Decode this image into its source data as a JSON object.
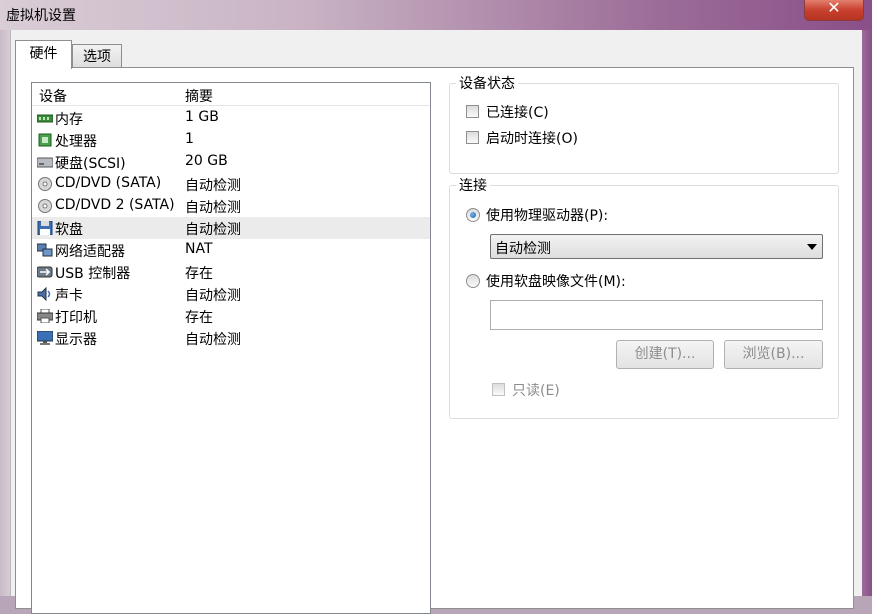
{
  "window": {
    "title": "虚拟机设置",
    "close_label": "✕"
  },
  "tabs": [
    {
      "label": "硬件"
    },
    {
      "label": "选项"
    }
  ],
  "device_list": {
    "columns": [
      "设备",
      "摘要"
    ],
    "rows": [
      {
        "name": "内存",
        "summary": "1 GB",
        "icon": "memory-icon"
      },
      {
        "name": "处理器",
        "summary": "1",
        "icon": "processor-icon"
      },
      {
        "name": "硬盘(SCSI)",
        "summary": "20 GB",
        "icon": "harddisk-icon"
      },
      {
        "name": "CD/DVD (SATA)",
        "summary": "自动检测",
        "icon": "cd-dvd-icon"
      },
      {
        "name": "CD/DVD 2 (SATA)",
        "summary": "自动检测",
        "icon": "cd-dvd-icon"
      },
      {
        "name": "软盘",
        "summary": "自动检测",
        "icon": "floppy-icon",
        "selected": true
      },
      {
        "name": "网络适配器",
        "summary": "NAT",
        "icon": "network-adapter-icon"
      },
      {
        "name": "USB 控制器",
        "summary": "存在",
        "icon": "usb-icon"
      },
      {
        "name": "声卡",
        "summary": "自动检测",
        "icon": "sound-card-icon"
      },
      {
        "name": "打印机",
        "summary": "存在",
        "icon": "printer-icon"
      },
      {
        "name": "显示器",
        "summary": "自动检测",
        "icon": "display-icon"
      }
    ]
  },
  "device_status": {
    "title": "设备状态",
    "connected": {
      "label": "已连接(C)",
      "checked": false
    },
    "connect_at_power_on": {
      "label": "启动时连接(O)",
      "checked": false
    }
  },
  "connection": {
    "title": "连接",
    "use_physical_drive": {
      "label": "使用物理驱动器(P):",
      "selected": true
    },
    "physical_drive_value": "自动检测",
    "use_image_file": {
      "label": "使用软盘映像文件(M):",
      "selected": false
    },
    "image_file_value": "",
    "create_button": "创建(T)...",
    "browse_button": "浏览(B)...",
    "read_only": {
      "label": "只读(E)",
      "checked": false
    }
  },
  "colors": {
    "title_gradient_end": "#8a4f89",
    "close_button": "#c8402e",
    "radio_dot": "#1c5da8"
  }
}
